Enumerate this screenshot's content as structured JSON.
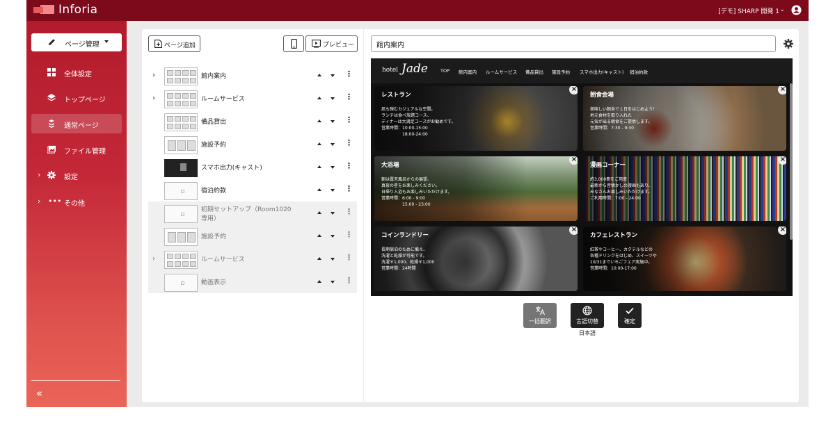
{
  "app": {
    "title": "Inforia",
    "account": "[デモ] SHARP 開発 1"
  },
  "sidebar": {
    "page_manage_label": "ページ管理",
    "items": [
      {
        "label": "全体設定"
      },
      {
        "label": "トップページ"
      },
      {
        "label": "通常ページ"
      },
      {
        "label": "ファイル管理"
      },
      {
        "label": "設定"
      },
      {
        "label": "その他"
      }
    ],
    "collapse": "«"
  },
  "toolbar": {
    "add_page_label": "ページ追加",
    "preview_label": "プレビュー"
  },
  "pages": [
    {
      "name": "館内案内",
      "expand": "›"
    },
    {
      "name": "ルームサービス",
      "expand": "›"
    },
    {
      "name": "備品貸出"
    },
    {
      "name": "施設予約"
    },
    {
      "name": "スマホ出力(キャスト)"
    },
    {
      "name": "宿泊約款"
    },
    {
      "name": "初期セットアップ（Room1020 専用）"
    },
    {
      "name": "施設予約"
    },
    {
      "name": "ルームサービス",
      "expand": "›"
    },
    {
      "name": "動画表示"
    }
  ],
  "editor": {
    "title_value": "館内案内"
  },
  "preview": {
    "hotel_small": "hotel",
    "hotel_big": "Jade",
    "nav": [
      "TOP",
      "館内案内",
      "ルームサービス",
      "備品貸出",
      "施設予約",
      "スマホ出力(キャスト)",
      "宿泊約款"
    ],
    "cards": [
      {
        "title": "レストラン",
        "desc": "凪も弾むカジュアルな空間。\nランチは食べ放題コース、\nディナーは大満足コースがお勧めです。\n営業時間：10:00-15:00\n　　　　　18:00-24:00"
      },
      {
        "title": "朝食会場",
        "desc": "美味しい朝食で１日をはじめよう！\n地元食材を取り入れた\n元気が出る朝食をご提供します。\n営業時間：7:30 - 9:30"
      },
      {
        "title": "大浴場",
        "desc": "朝は露天風呂からの展望、\n真夜の星をお楽しみください。\n日帰り入浴もお楽しみいただけます。\n営業時間：6:00 - 9:00\n　　　　　15:00 - 23:00"
      },
      {
        "title": "漫画コーナー",
        "desc": "約3,000冊をご用意\n最新から昔懐かしの漫画もあり、\nみなさんお楽しみいただけます。\nご利用時間：7:00 - 24:00"
      },
      {
        "title": "コインランドリー",
        "desc": "長期宿泊のために備え、\n洗濯と乾燥が可能です。\n洗濯￥1,000、乾燥￥1,000\n営業時間：24時間"
      },
      {
        "title": "カフェレストラン",
        "desc": "紅茶やコーヒー、カクテルなどの\n各種ドリンクをはじめ、スイーツや\n10/31までいちごフェア実施中。\n営業時間：10:00-17:00"
      }
    ],
    "close": "×"
  },
  "actions": {
    "translate_label": "一括翻訳",
    "language_label": "言語切替",
    "confirm_label": "確定",
    "current_language": "日本語"
  }
}
